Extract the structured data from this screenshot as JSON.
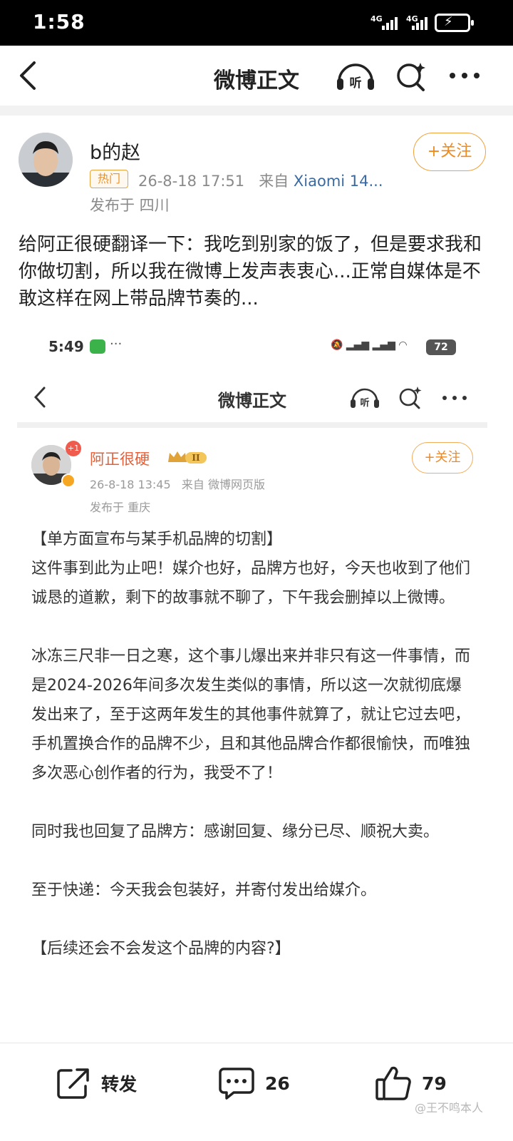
{
  "status_bar": {
    "time": "1:58",
    "network_1": "4G",
    "network_2": "4G"
  },
  "nav": {
    "title": "微博正文",
    "icons": [
      "back-arrow-icon",
      "listen-headphones-icon",
      "search-icon",
      "more-icon"
    ]
  },
  "post": {
    "username": "b的赵",
    "badge": "热门",
    "datetime": "26-8-18 17:51",
    "from_prefix": "来自",
    "device": "Xiaomi 14...",
    "location": "发布于 四川",
    "follow_label": "+关注",
    "text": "给阿正很硬翻译一下：我吃到别家的饭了，但是要求我和你做切割，所以我在微博上发声表衷心...正常自媒体是不敢这样在网上带品牌节奏的..."
  },
  "embedded": {
    "time": "5:49",
    "battery": "72",
    "nav_title": "微博正文",
    "author": "阿正很硬",
    "vip_badge": "+1",
    "level_badge": "II",
    "datetime": "26-8-18 13:45",
    "source": "来自 微博网页版",
    "location": "发布于 重庆",
    "follow_label": "+关注",
    "paragraphs": [
      "【单方面宣布与某手机品牌的切割】\n这件事到此为止吧！媒介也好，品牌方也好，今天也收到了他们诚恳的道歉，剩下的故事就不聊了，下午我会删掉以上微博。",
      "冰冻三尺非一日之寒，这个事儿爆出来并非只有这一件事情，而是2024-2026年间多次发生类似的事情，所以这一次就彻底爆发出来了，至于这两年发生的其他事件就算了，就让它过去吧，手机置换合作的品牌不少，且和其他品牌合作都很愉快，而唯独多次恶心创作者的行为，我受不了！",
      "同时我也回复了品牌方：感谢回复、缘分已尽、顺祝大卖。",
      "至于快递：今天我会包装好，并寄付发出给媒介。",
      "【后续还会不会发这个品牌的内容?】"
    ]
  },
  "toolbar": {
    "repost_label": "转发",
    "comment_count": "26",
    "like_count": "79"
  },
  "watermark": "@王不鸣本人",
  "colors": {
    "accent_orange": "#f08a1c",
    "link_blue": "#3b6aa0",
    "author_orange": "#e3603a"
  }
}
